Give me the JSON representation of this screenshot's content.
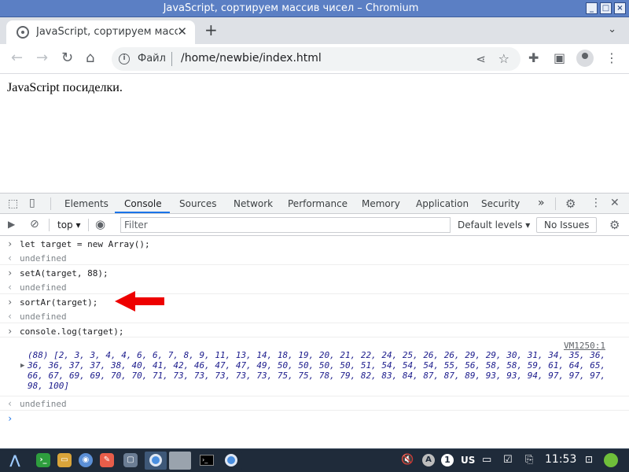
{
  "window": {
    "title": "JavaScript, сортируем массив чисел – Chromium"
  },
  "tab": {
    "title": "JavaScript, сортируем масс",
    "close": "✕"
  },
  "toolbar": {
    "scheme_label": "Файл",
    "url": "/home/newbie/index.html"
  },
  "page": {
    "text": "JavaScript посиделки."
  },
  "devtools": {
    "tabs": [
      "Elements",
      "Console",
      "Sources",
      "Network",
      "Performance",
      "Memory",
      "Application",
      "Security"
    ],
    "more": "»",
    "context": "top",
    "filter_placeholder": "Filter",
    "levels": "Default levels ▾",
    "no_issues": "No Issues"
  },
  "console": {
    "entries": [
      {
        "command": "let target = new Array();",
        "result": "undefined"
      },
      {
        "command": "setA(target, 88);",
        "result": "undefined"
      },
      {
        "command": "sortAr(target);",
        "result": "undefined"
      },
      {
        "command": "console.log(target);"
      }
    ],
    "log_source": "VM1250:1",
    "log_output": "(88) [2, 3, 3, 4, 4, 6, 6, 7, 8, 9, 11, 13, 14, 18, 19, 20, 21, 22, 24, 25, 26, 26, 29, 29, 30, 31, 34, 35, 36, 36, 36, 37, 37, 38, 40, 41, 42, 46, 47, 47, 49, 50, 50, 50, 50, 51, 54, 54, 54, 55, 56, 58, 58, 59, 61, 64, 65, 66, 67, 69, 69, 70, 70, 71, 73, 73, 73, 73, 73, 75, 75, 78, 79, 82, 83, 84, 87, 87, 89, 93, 93, 94, 97, 97, 97, 98, 100]",
    "final_result": "undefined"
  },
  "taskbar": {
    "keyboard_layout": "US",
    "clock": "11:53",
    "badge_count": "1"
  },
  "colors": {
    "titlebar": "#5b7fc4",
    "active_tab_underline": "#1a73e8",
    "annotation_arrow": "#ee0000",
    "taskbar": "#1f2b3a"
  }
}
